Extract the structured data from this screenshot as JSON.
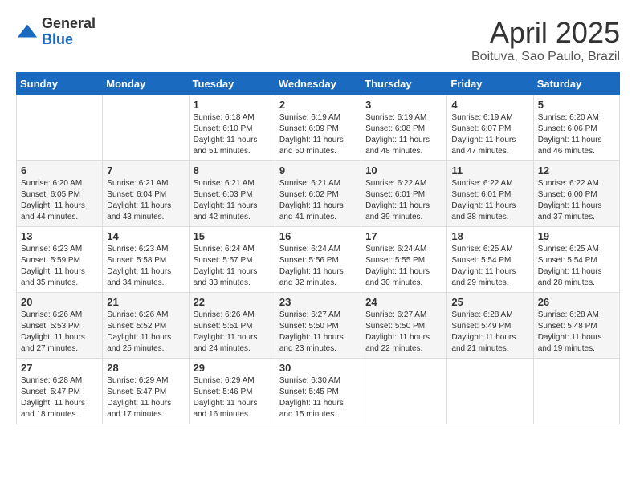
{
  "header": {
    "logo_general": "General",
    "logo_blue": "Blue",
    "month_title": "April 2025",
    "location": "Boituva, Sao Paulo, Brazil"
  },
  "weekdays": [
    "Sunday",
    "Monday",
    "Tuesday",
    "Wednesday",
    "Thursday",
    "Friday",
    "Saturday"
  ],
  "weeks": [
    [
      {
        "day": "",
        "sunrise": "",
        "sunset": "",
        "daylight": ""
      },
      {
        "day": "",
        "sunrise": "",
        "sunset": "",
        "daylight": ""
      },
      {
        "day": "1",
        "sunrise": "Sunrise: 6:18 AM",
        "sunset": "Sunset: 6:10 PM",
        "daylight": "Daylight: 11 hours and 51 minutes."
      },
      {
        "day": "2",
        "sunrise": "Sunrise: 6:19 AM",
        "sunset": "Sunset: 6:09 PM",
        "daylight": "Daylight: 11 hours and 50 minutes."
      },
      {
        "day": "3",
        "sunrise": "Sunrise: 6:19 AM",
        "sunset": "Sunset: 6:08 PM",
        "daylight": "Daylight: 11 hours and 48 minutes."
      },
      {
        "day": "4",
        "sunrise": "Sunrise: 6:19 AM",
        "sunset": "Sunset: 6:07 PM",
        "daylight": "Daylight: 11 hours and 47 minutes."
      },
      {
        "day": "5",
        "sunrise": "Sunrise: 6:20 AM",
        "sunset": "Sunset: 6:06 PM",
        "daylight": "Daylight: 11 hours and 46 minutes."
      }
    ],
    [
      {
        "day": "6",
        "sunrise": "Sunrise: 6:20 AM",
        "sunset": "Sunset: 6:05 PM",
        "daylight": "Daylight: 11 hours and 44 minutes."
      },
      {
        "day": "7",
        "sunrise": "Sunrise: 6:21 AM",
        "sunset": "Sunset: 6:04 PM",
        "daylight": "Daylight: 11 hours and 43 minutes."
      },
      {
        "day": "8",
        "sunrise": "Sunrise: 6:21 AM",
        "sunset": "Sunset: 6:03 PM",
        "daylight": "Daylight: 11 hours and 42 minutes."
      },
      {
        "day": "9",
        "sunrise": "Sunrise: 6:21 AM",
        "sunset": "Sunset: 6:02 PM",
        "daylight": "Daylight: 11 hours and 41 minutes."
      },
      {
        "day": "10",
        "sunrise": "Sunrise: 6:22 AM",
        "sunset": "Sunset: 6:01 PM",
        "daylight": "Daylight: 11 hours and 39 minutes."
      },
      {
        "day": "11",
        "sunrise": "Sunrise: 6:22 AM",
        "sunset": "Sunset: 6:01 PM",
        "daylight": "Daylight: 11 hours and 38 minutes."
      },
      {
        "day": "12",
        "sunrise": "Sunrise: 6:22 AM",
        "sunset": "Sunset: 6:00 PM",
        "daylight": "Daylight: 11 hours and 37 minutes."
      }
    ],
    [
      {
        "day": "13",
        "sunrise": "Sunrise: 6:23 AM",
        "sunset": "Sunset: 5:59 PM",
        "daylight": "Daylight: 11 hours and 35 minutes."
      },
      {
        "day": "14",
        "sunrise": "Sunrise: 6:23 AM",
        "sunset": "Sunset: 5:58 PM",
        "daylight": "Daylight: 11 hours and 34 minutes."
      },
      {
        "day": "15",
        "sunrise": "Sunrise: 6:24 AM",
        "sunset": "Sunset: 5:57 PM",
        "daylight": "Daylight: 11 hours and 33 minutes."
      },
      {
        "day": "16",
        "sunrise": "Sunrise: 6:24 AM",
        "sunset": "Sunset: 5:56 PM",
        "daylight": "Daylight: 11 hours and 32 minutes."
      },
      {
        "day": "17",
        "sunrise": "Sunrise: 6:24 AM",
        "sunset": "Sunset: 5:55 PM",
        "daylight": "Daylight: 11 hours and 30 minutes."
      },
      {
        "day": "18",
        "sunrise": "Sunrise: 6:25 AM",
        "sunset": "Sunset: 5:54 PM",
        "daylight": "Daylight: 11 hours and 29 minutes."
      },
      {
        "day": "19",
        "sunrise": "Sunrise: 6:25 AM",
        "sunset": "Sunset: 5:54 PM",
        "daylight": "Daylight: 11 hours and 28 minutes."
      }
    ],
    [
      {
        "day": "20",
        "sunrise": "Sunrise: 6:26 AM",
        "sunset": "Sunset: 5:53 PM",
        "daylight": "Daylight: 11 hours and 27 minutes."
      },
      {
        "day": "21",
        "sunrise": "Sunrise: 6:26 AM",
        "sunset": "Sunset: 5:52 PM",
        "daylight": "Daylight: 11 hours and 25 minutes."
      },
      {
        "day": "22",
        "sunrise": "Sunrise: 6:26 AM",
        "sunset": "Sunset: 5:51 PM",
        "daylight": "Daylight: 11 hours and 24 minutes."
      },
      {
        "day": "23",
        "sunrise": "Sunrise: 6:27 AM",
        "sunset": "Sunset: 5:50 PM",
        "daylight": "Daylight: 11 hours and 23 minutes."
      },
      {
        "day": "24",
        "sunrise": "Sunrise: 6:27 AM",
        "sunset": "Sunset: 5:50 PM",
        "daylight": "Daylight: 11 hours and 22 minutes."
      },
      {
        "day": "25",
        "sunrise": "Sunrise: 6:28 AM",
        "sunset": "Sunset: 5:49 PM",
        "daylight": "Daylight: 11 hours and 21 minutes."
      },
      {
        "day": "26",
        "sunrise": "Sunrise: 6:28 AM",
        "sunset": "Sunset: 5:48 PM",
        "daylight": "Daylight: 11 hours and 19 minutes."
      }
    ],
    [
      {
        "day": "27",
        "sunrise": "Sunrise: 6:28 AM",
        "sunset": "Sunset: 5:47 PM",
        "daylight": "Daylight: 11 hours and 18 minutes."
      },
      {
        "day": "28",
        "sunrise": "Sunrise: 6:29 AM",
        "sunset": "Sunset: 5:47 PM",
        "daylight": "Daylight: 11 hours and 17 minutes."
      },
      {
        "day": "29",
        "sunrise": "Sunrise: 6:29 AM",
        "sunset": "Sunset: 5:46 PM",
        "daylight": "Daylight: 11 hours and 16 minutes."
      },
      {
        "day": "30",
        "sunrise": "Sunrise: 6:30 AM",
        "sunset": "Sunset: 5:45 PM",
        "daylight": "Daylight: 11 hours and 15 minutes."
      },
      {
        "day": "",
        "sunrise": "",
        "sunset": "",
        "daylight": ""
      },
      {
        "day": "",
        "sunrise": "",
        "sunset": "",
        "daylight": ""
      },
      {
        "day": "",
        "sunrise": "",
        "sunset": "",
        "daylight": ""
      }
    ]
  ]
}
